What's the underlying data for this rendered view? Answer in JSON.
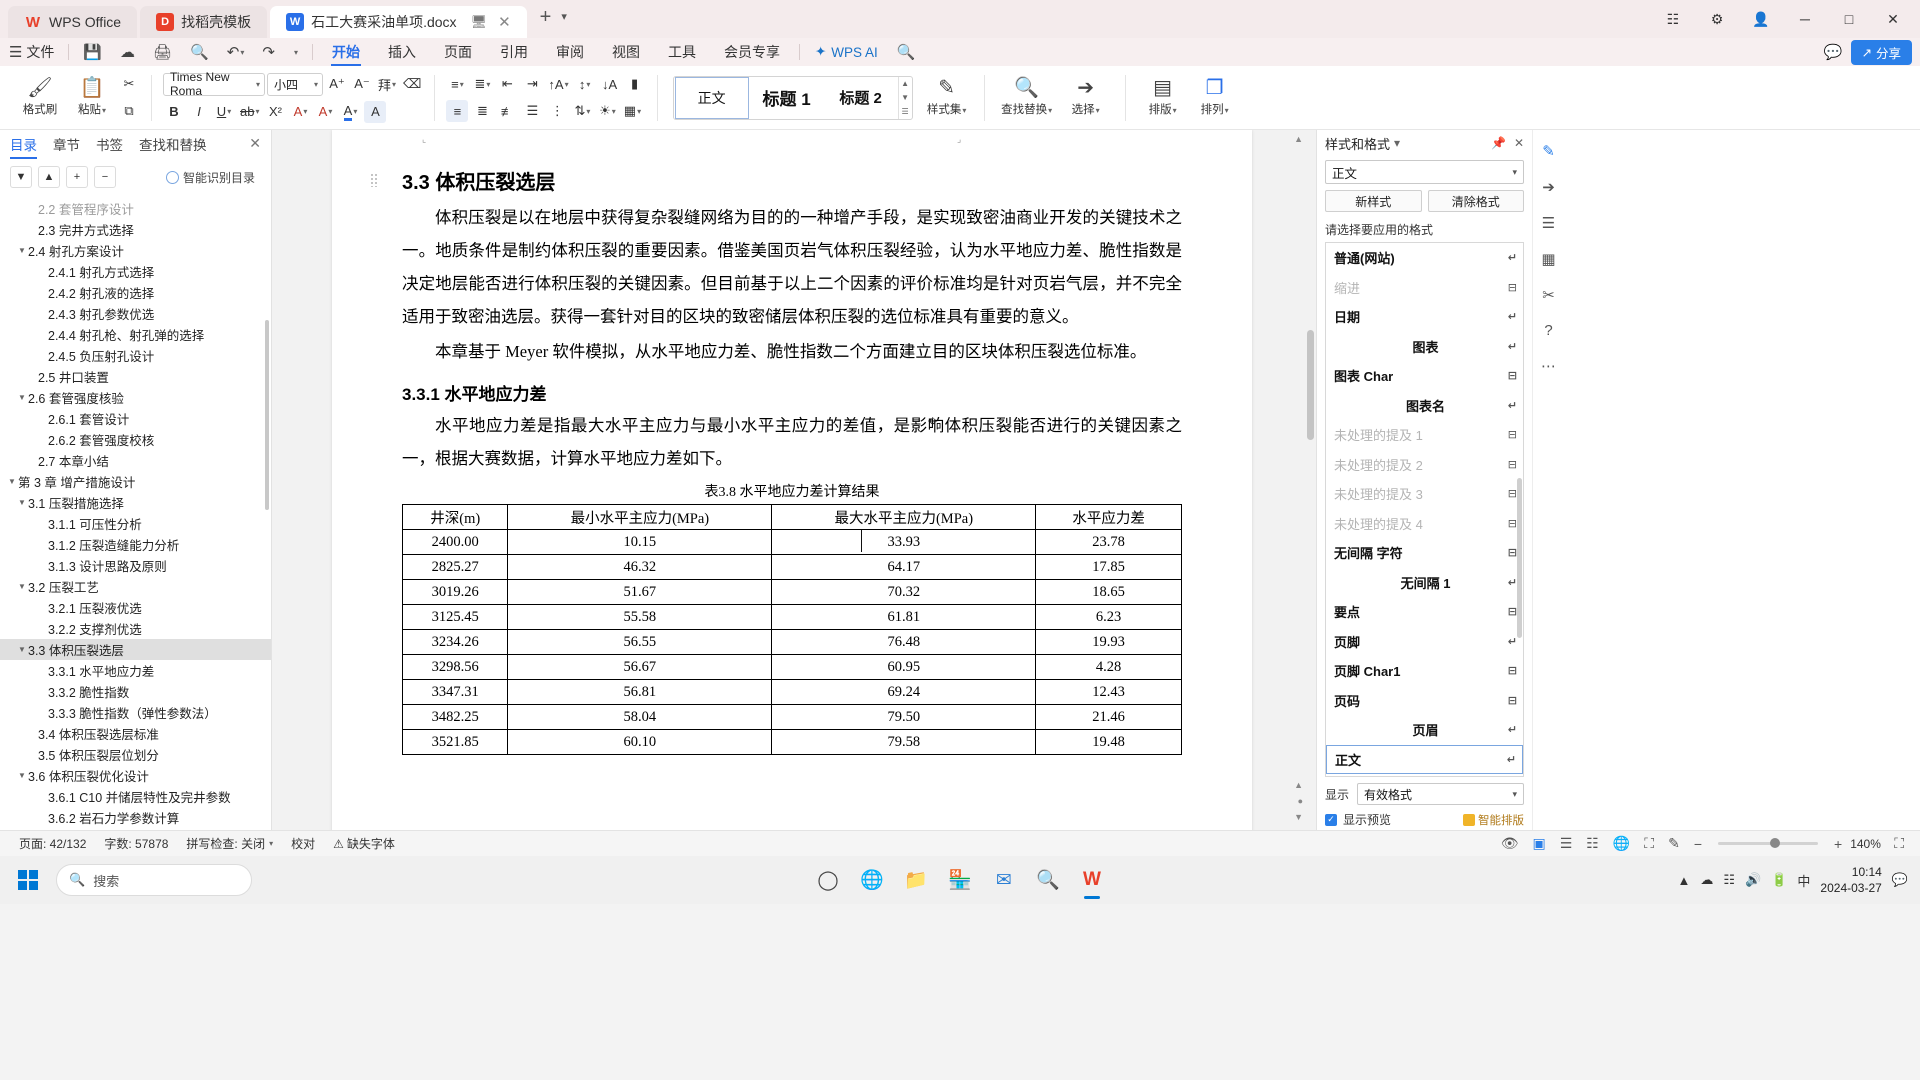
{
  "window": {
    "tabs": [
      {
        "label": "WPS Office",
        "icon": "wps-logo-icon",
        "active": false
      },
      {
        "label": "找稻壳模板",
        "icon": "docer-icon",
        "active": false
      },
      {
        "label": "石工大赛采油单项.docx",
        "icon": "word-doc-icon",
        "active": true
      }
    ],
    "new_tab_label": "+",
    "controls": {
      "minimize": "─",
      "maximize": "□",
      "close": "✕",
      "restore": "❐"
    }
  },
  "menubar": {
    "file_label": "文件",
    "quick_icons": [
      "save-icon",
      "cloud-save-icon",
      "print-icon",
      "print-preview-icon",
      "undo-icon",
      "redo-icon",
      "customize-icon"
    ],
    "tabs": [
      {
        "label": "开始",
        "active": true
      },
      {
        "label": "插入",
        "active": false
      },
      {
        "label": "页面",
        "active": false
      },
      {
        "label": "引用",
        "active": false
      },
      {
        "label": "审阅",
        "active": false
      },
      {
        "label": "视图",
        "active": false
      },
      {
        "label": "工具",
        "active": false
      },
      {
        "label": "会员专享",
        "active": false
      }
    ],
    "ai_label": "WPS AI",
    "search_icon": "search-icon",
    "share_label": "分享",
    "comment_icon": "comment-icon",
    "collab_icon": "collaborate-icon"
  },
  "ribbon": {
    "format_painter": "格式刷",
    "paste": "粘贴",
    "cut_icon": "scissors-icon",
    "copy_icon": "copy-icon",
    "font_name": "Times New Roma",
    "font_size": "小四",
    "grow_font": "A⁺",
    "shrink_font": "A⁻",
    "pinyin_guide": "拼音指南",
    "clear_format": "清除格式",
    "bold": "B",
    "italic": "I",
    "underline": "U",
    "strikethrough": "ab",
    "superscript": "X²",
    "text_effect": "A",
    "highlight": "A",
    "font_color": "A",
    "char_shading": "A",
    "bullets_icon": "bullet-list-icon",
    "numbering_icon": "numbered-list-icon",
    "decrease_indent_icon": "decrease-indent-icon",
    "increase_indent_icon": "increase-indent-icon",
    "align_left_icon": "align-left-icon",
    "align_center_icon": "align-center-icon",
    "align_right_icon": "align-right-icon",
    "justify_icon": "justify-icon",
    "distribute_icon": "distribute-icon",
    "line_spacing_icon": "line-spacing-icon",
    "shading_icon": "shading-icon",
    "borders_icon": "borders-icon",
    "sort_icon": "sort-icon",
    "show_marks_icon": "show-paragraph-marks-icon",
    "phonetic_icon": "phonetic-icon",
    "style_gallery": [
      {
        "label": "正文",
        "selected": true
      },
      {
        "label": "标题 1",
        "selected": false
      },
      {
        "label": "标题 2",
        "selected": false
      }
    ],
    "style_set": "样式集",
    "find_replace": "查找替换",
    "select": "选择",
    "typeset": "排版",
    "arrange": "排列"
  },
  "left_panel": {
    "tabs": [
      {
        "label": "目录",
        "active": true
      },
      {
        "label": "章节",
        "active": false
      },
      {
        "label": "书签",
        "active": false
      },
      {
        "label": "查找和替换",
        "active": false
      }
    ],
    "close_icon": "close-icon",
    "toolbar_buttons": [
      "下一级",
      "上一级",
      "展开",
      "折叠"
    ],
    "smart_toc_label": "智能识别目录",
    "items": [
      {
        "label": "2.2 套管程序设计",
        "indent": 2,
        "arrow": "",
        "selected": false,
        "cut": true
      },
      {
        "label": "2.3  完井方式选择",
        "indent": 2,
        "arrow": "",
        "selected": false
      },
      {
        "label": "2.4  射孔方案设计",
        "indent": 1,
        "arrow": "▼",
        "selected": false
      },
      {
        "label": "2.4.1  射孔方式选择",
        "indent": 3,
        "arrow": "",
        "selected": false
      },
      {
        "label": "2.4.2  射孔液的选择",
        "indent": 3,
        "arrow": "",
        "selected": false
      },
      {
        "label": "2.4.3  射孔参数优选",
        "indent": 3,
        "arrow": "",
        "selected": false
      },
      {
        "label": "2.4.4  射孔枪、射孔弹的选择",
        "indent": 3,
        "arrow": "",
        "selected": false
      },
      {
        "label": "2.4.5  负压射孔设计",
        "indent": 3,
        "arrow": "",
        "selected": false
      },
      {
        "label": "2.5  井口装置",
        "indent": 2,
        "arrow": "",
        "selected": false
      },
      {
        "label": "2.6  套管强度核验",
        "indent": 1,
        "arrow": "▼",
        "selected": false
      },
      {
        "label": "2.6.1  套管设计",
        "indent": 3,
        "arrow": "",
        "selected": false
      },
      {
        "label": "2.6.2  套管强度校核",
        "indent": 3,
        "arrow": "",
        "selected": false
      },
      {
        "label": "2.7  本章小结",
        "indent": 2,
        "arrow": "",
        "selected": false
      },
      {
        "label": "第 3 章  增产措施设计",
        "indent": 0,
        "arrow": "▼",
        "selected": false
      },
      {
        "label": "3.1  压裂措施选择",
        "indent": 1,
        "arrow": "▼",
        "selected": false
      },
      {
        "label": "3.1.1  可压性分析",
        "indent": 3,
        "arrow": "",
        "selected": false
      },
      {
        "label": "3.1.2  压裂造缝能力分析",
        "indent": 3,
        "arrow": "",
        "selected": false
      },
      {
        "label": "3.1.3  设计思路及原则",
        "indent": 3,
        "arrow": "",
        "selected": false
      },
      {
        "label": "3.2 压裂工艺",
        "indent": 1,
        "arrow": "▼",
        "selected": false
      },
      {
        "label": "3.2.1  压裂液优选",
        "indent": 3,
        "arrow": "",
        "selected": false
      },
      {
        "label": "3.2.2 支撑剂优选",
        "indent": 3,
        "arrow": "",
        "selected": false
      },
      {
        "label": "3.3 体积压裂选层",
        "indent": 1,
        "arrow": "▼",
        "selected": true
      },
      {
        "label": "3.3.1  水平地应力差",
        "indent": 3,
        "arrow": "",
        "selected": false
      },
      {
        "label": "3.3.2  脆性指数",
        "indent": 3,
        "arrow": "",
        "selected": false
      },
      {
        "label": "3.3.3  脆性指数（弹性参数法）",
        "indent": 3,
        "arrow": "",
        "selected": false
      },
      {
        "label": "3.4  体积压裂选层标准",
        "indent": 2,
        "arrow": "",
        "selected": false
      },
      {
        "label": "3.5  体积压裂层位划分",
        "indent": 2,
        "arrow": "",
        "selected": false
      },
      {
        "label": "3.6  体积压裂优化设计",
        "indent": 1,
        "arrow": "▼",
        "selected": false
      },
      {
        "label": "3.6.1 C10 并储层特性及完井参数",
        "indent": 3,
        "arrow": "",
        "selected": false
      },
      {
        "label": "3.6.2  岩石力学参数计算",
        "indent": 3,
        "arrow": "",
        "selected": false
      }
    ]
  },
  "document": {
    "heading_2": "3.3 体积压裂选层",
    "paragraph_1": "体积压裂是以在地层中获得复杂裂缝网络为目的的一种增产手段，是实现致密油商业开发的关键技术之一。地质条件是制约体积压裂的重要因素。借鉴美国页岩气体积压裂经验，认为水平地应力差、脆性指数是决定地层能否进行体积压裂的关键因素。但目前基于以上二个因素的评价标准均是针对页岩气层，并不完全适用于致密油选层。获得一套针对目的区块的致密储层体积压裂的选位标准具有重要的意义。",
    "paragraph_2": "本章基于 Meyer 软件模拟，从水平地应力差、脆性指数二个方面建立目的区块体积压裂选位标准。",
    "heading_3": "3.3.1  水平地应力差",
    "paragraph_3": "水平地应力差是指最大水平主应力与最小水平主应力的差值，是影响体积压裂能否进行的关键因素之一，根据大赛数据，计算水平地应力差如下。",
    "table_caption": "表3.8  水平地应力差计算结果",
    "table": {
      "headers": [
        "井深(m)",
        "最小水平主应力(MPa)",
        "最大水平主应力(MPa)",
        "水平应力差"
      ],
      "rows": [
        [
          "2400.00",
          "10.15",
          "33.93",
          "23.78"
        ],
        [
          "2825.27",
          "46.32",
          "64.17",
          "17.85"
        ],
        [
          "3019.26",
          "51.67",
          "70.32",
          "18.65"
        ],
        [
          "3125.45",
          "55.58",
          "61.81",
          "6.23"
        ],
        [
          "3234.26",
          "56.55",
          "76.48",
          "19.93"
        ],
        [
          "3298.56",
          "56.67",
          "60.95",
          "4.28"
        ],
        [
          "3347.31",
          "56.81",
          "69.24",
          "12.43"
        ],
        [
          "3482.25",
          "58.04",
          "79.50",
          "21.46"
        ],
        [
          "3521.85",
          "60.10",
          "79.58",
          "19.48"
        ]
      ]
    }
  },
  "right_panel": {
    "title": "样式和格式",
    "pin_icon": "pin-icon",
    "close_icon": "close-icon",
    "current_style": "正文",
    "new_style_btn": "新样式",
    "clear_format_btn": "清除格式",
    "list_label": "请选择要应用的格式",
    "styles": [
      {
        "label": "普通(网站)",
        "bold": true,
        "mark": "↵"
      },
      {
        "label": "缩进",
        "gray": true,
        "mark": "⊟"
      },
      {
        "label": "日期",
        "bold": true,
        "mark": "↵"
      },
      {
        "label": "图表",
        "bold": true,
        "center": true,
        "mark": "↵"
      },
      {
        "label": "图表 Char",
        "bold": true,
        "mark": "⊟"
      },
      {
        "label": "图表名",
        "bold": true,
        "center": true,
        "mark": "↵"
      },
      {
        "label": "未处理的提及 1",
        "gray": true,
        "mark": "⊟"
      },
      {
        "label": "未处理的提及 2",
        "gray": true,
        "mark": "⊟"
      },
      {
        "label": "未处理的提及 3",
        "gray": true,
        "mark": "⊟"
      },
      {
        "label": "未处理的提及 4",
        "gray": true,
        "mark": "⊟"
      },
      {
        "label": "无间隔 字符",
        "bold": true,
        "mark": "⊟"
      },
      {
        "label": "无间隔 1",
        "bold": true,
        "center": true,
        "mark": "↵"
      },
      {
        "label": "要点",
        "bold": true,
        "mark": "⊟"
      },
      {
        "label": "页脚",
        "bold": true,
        "mark": "↵"
      },
      {
        "label": "页脚 Char1",
        "bold": true,
        "mark": "⊟"
      },
      {
        "label": "页码",
        "bold": true,
        "mark": "⊟"
      },
      {
        "label": "页眉",
        "bold": true,
        "center": true,
        "mark": "↵"
      },
      {
        "label": "正文",
        "bold": true,
        "selected": true,
        "mark": "↵"
      }
    ],
    "show_label": "显示",
    "show_value": "有效格式",
    "preview_label": "显示预览",
    "preview_checked": true,
    "smart_layout": "智能排版"
  },
  "rail_icons": [
    "edit-pen-icon",
    "cursor-select-icon",
    "picture-icon",
    "table-icon",
    "scissors-icon",
    "help-icon",
    "more-icon"
  ],
  "status_bar": {
    "page_info": "页面: 42/132",
    "word_count": "字数: 57878",
    "spellcheck": "拼写检查: 关闭",
    "proofread": "校对",
    "missing_font": "缺失字体",
    "view_icons": [
      "eye-icon",
      "page-view-icon",
      "outline-view-icon",
      "web-view-icon",
      "read-view-icon",
      "fullscreen-icon",
      "edit-icon"
    ],
    "zoom_out": "−",
    "zoom_in": "+",
    "zoom_value": "140%",
    "fit_icon": "fit-page-icon"
  },
  "taskbar": {
    "search_placeholder": "搜索",
    "search_icon": "search-icon",
    "start_icon": "windows-start-icon",
    "apps": [
      {
        "name": "task-view-icon",
        "glyph": "◯",
        "active": false
      },
      {
        "name": "edge-browser-icon",
        "glyph": "",
        "active": false
      },
      {
        "name": "file-explorer-icon",
        "glyph": "",
        "active": false
      },
      {
        "name": "store-icon",
        "glyph": "",
        "active": false
      },
      {
        "name": "mail-icon",
        "glyph": "",
        "active": false
      },
      {
        "name": "search-app-icon",
        "glyph": "",
        "active": false
      },
      {
        "name": "wps-writer-icon",
        "glyph": "W",
        "active": true
      }
    ],
    "tray": [
      "chevron-up-icon",
      "onedrive-icon",
      "network-icon",
      "volume-icon",
      "battery-icon",
      "ime-icon"
    ],
    "ime_label": "中",
    "clock_time": "10:14",
    "clock_date": "2024-03-27",
    "notification_icon": "notification-icon"
  },
  "colors": {
    "accent_blue": "#2a6fe8",
    "tab_bar_bg": "#f4ebec",
    "menu_bg": "#f7eff0",
    "selection_gray": "#dfdfdf",
    "share_blue": "#2a7fe8"
  }
}
